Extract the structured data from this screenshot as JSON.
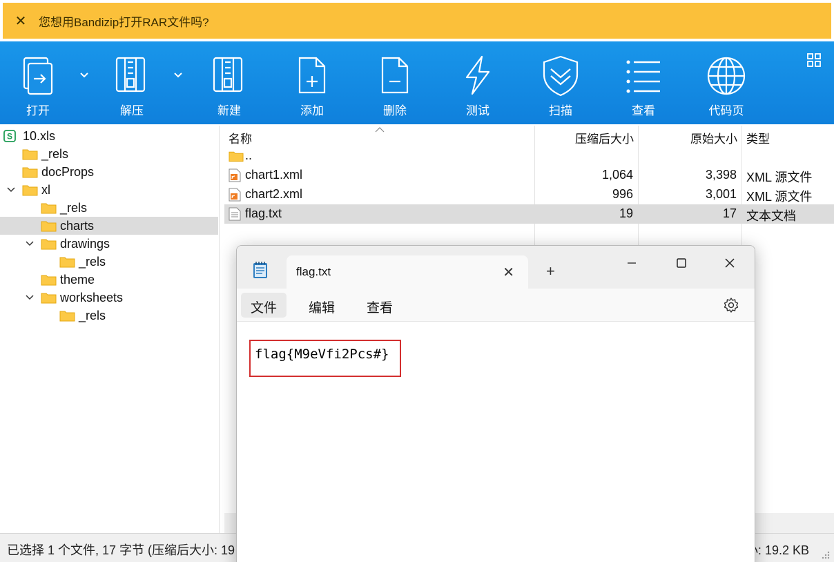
{
  "notification": {
    "text": "您想用Bandizip打开RAR文件吗?"
  },
  "toolbar": {
    "buttons": [
      {
        "label": "打开",
        "icon": "open-icon"
      },
      {
        "label": "解压",
        "icon": "extract-icon"
      },
      {
        "label": "新建",
        "icon": "new-archive-icon"
      },
      {
        "label": "添加",
        "icon": "add-file-icon"
      },
      {
        "label": "删除",
        "icon": "delete-file-icon"
      },
      {
        "label": "测试",
        "icon": "test-icon"
      },
      {
        "label": "扫描",
        "icon": "scan-icon"
      },
      {
        "label": "查看",
        "icon": "view-list-icon"
      },
      {
        "label": "代码页",
        "icon": "codepage-globe-icon"
      }
    ],
    "accent": "#1188e2"
  },
  "tree": {
    "items": [
      {
        "label": "10.xls"
      },
      {
        "label": "_rels"
      },
      {
        "label": "docProps"
      },
      {
        "label": "xl"
      },
      {
        "label": "_rels"
      },
      {
        "label": "charts"
      },
      {
        "label": "drawings"
      },
      {
        "label": "_rels"
      },
      {
        "label": "theme"
      },
      {
        "label": "worksheets"
      },
      {
        "label": "_rels"
      }
    ]
  },
  "filelist": {
    "headers": {
      "name": "名称",
      "compressed": "压缩后大小",
      "original": "原始大小",
      "type": "类型"
    },
    "rows": [
      {
        "name": "..",
        "compressed": "",
        "original": "",
        "type": ""
      },
      {
        "name": "chart1.xml",
        "compressed": "1,064",
        "original": "3,398",
        "type": "XML 源文件"
      },
      {
        "name": "chart2.xml",
        "compressed": "996",
        "original": "3,001",
        "type": "XML 源文件"
      },
      {
        "name": "flag.txt",
        "compressed": "19",
        "original": "17",
        "type": "文本文档"
      }
    ]
  },
  "status": {
    "left": "已选择 1 个文件, 17 字节 (压缩后大小: 19",
    "right": "小: 19.2 KB"
  },
  "notepad": {
    "tab_title": "flag.txt",
    "menu": {
      "file": "文件",
      "edit": "编辑",
      "view": "查看"
    },
    "content": "flag{M9eVfi2Pcs#}",
    "highlight_color": "#d32f2f"
  }
}
